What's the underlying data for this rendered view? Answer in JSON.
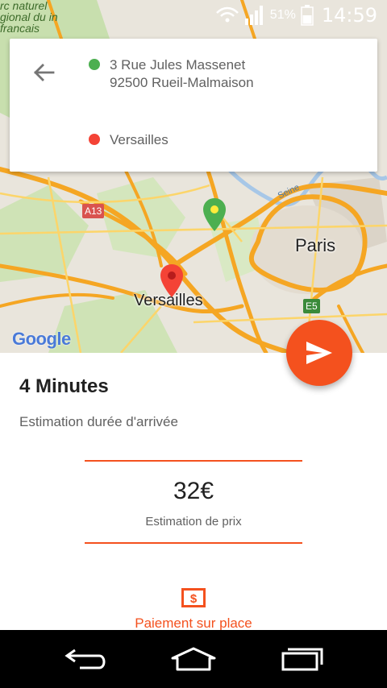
{
  "status_bar": {
    "battery_percent": "51%",
    "time": "14:59",
    "icons": [
      "wifi-icon",
      "signal-icon",
      "battery-icon"
    ]
  },
  "map": {
    "top_left_label": "rc naturel gional du in francais",
    "labels": {
      "city_paris": "Paris",
      "city_versailles": "Versailles",
      "road_a13": "A13",
      "road_e5": "E5",
      "river": "Seine",
      "attribution": "Google"
    }
  },
  "route": {
    "origin_line1": "3 Rue Jules Massenet",
    "origin_line2": "92500 Rueil-Malmaison",
    "destination": "Versailles",
    "origin_color": "#4caf50",
    "destination_color": "#f44336"
  },
  "trip": {
    "duration": "4 Minutes",
    "duration_label": "Estimation durée d'arrivée",
    "price": "32€",
    "price_label": "Estimation de prix",
    "payment_label": "Paiement sur place"
  },
  "colors": {
    "accent": "#f4511e"
  }
}
